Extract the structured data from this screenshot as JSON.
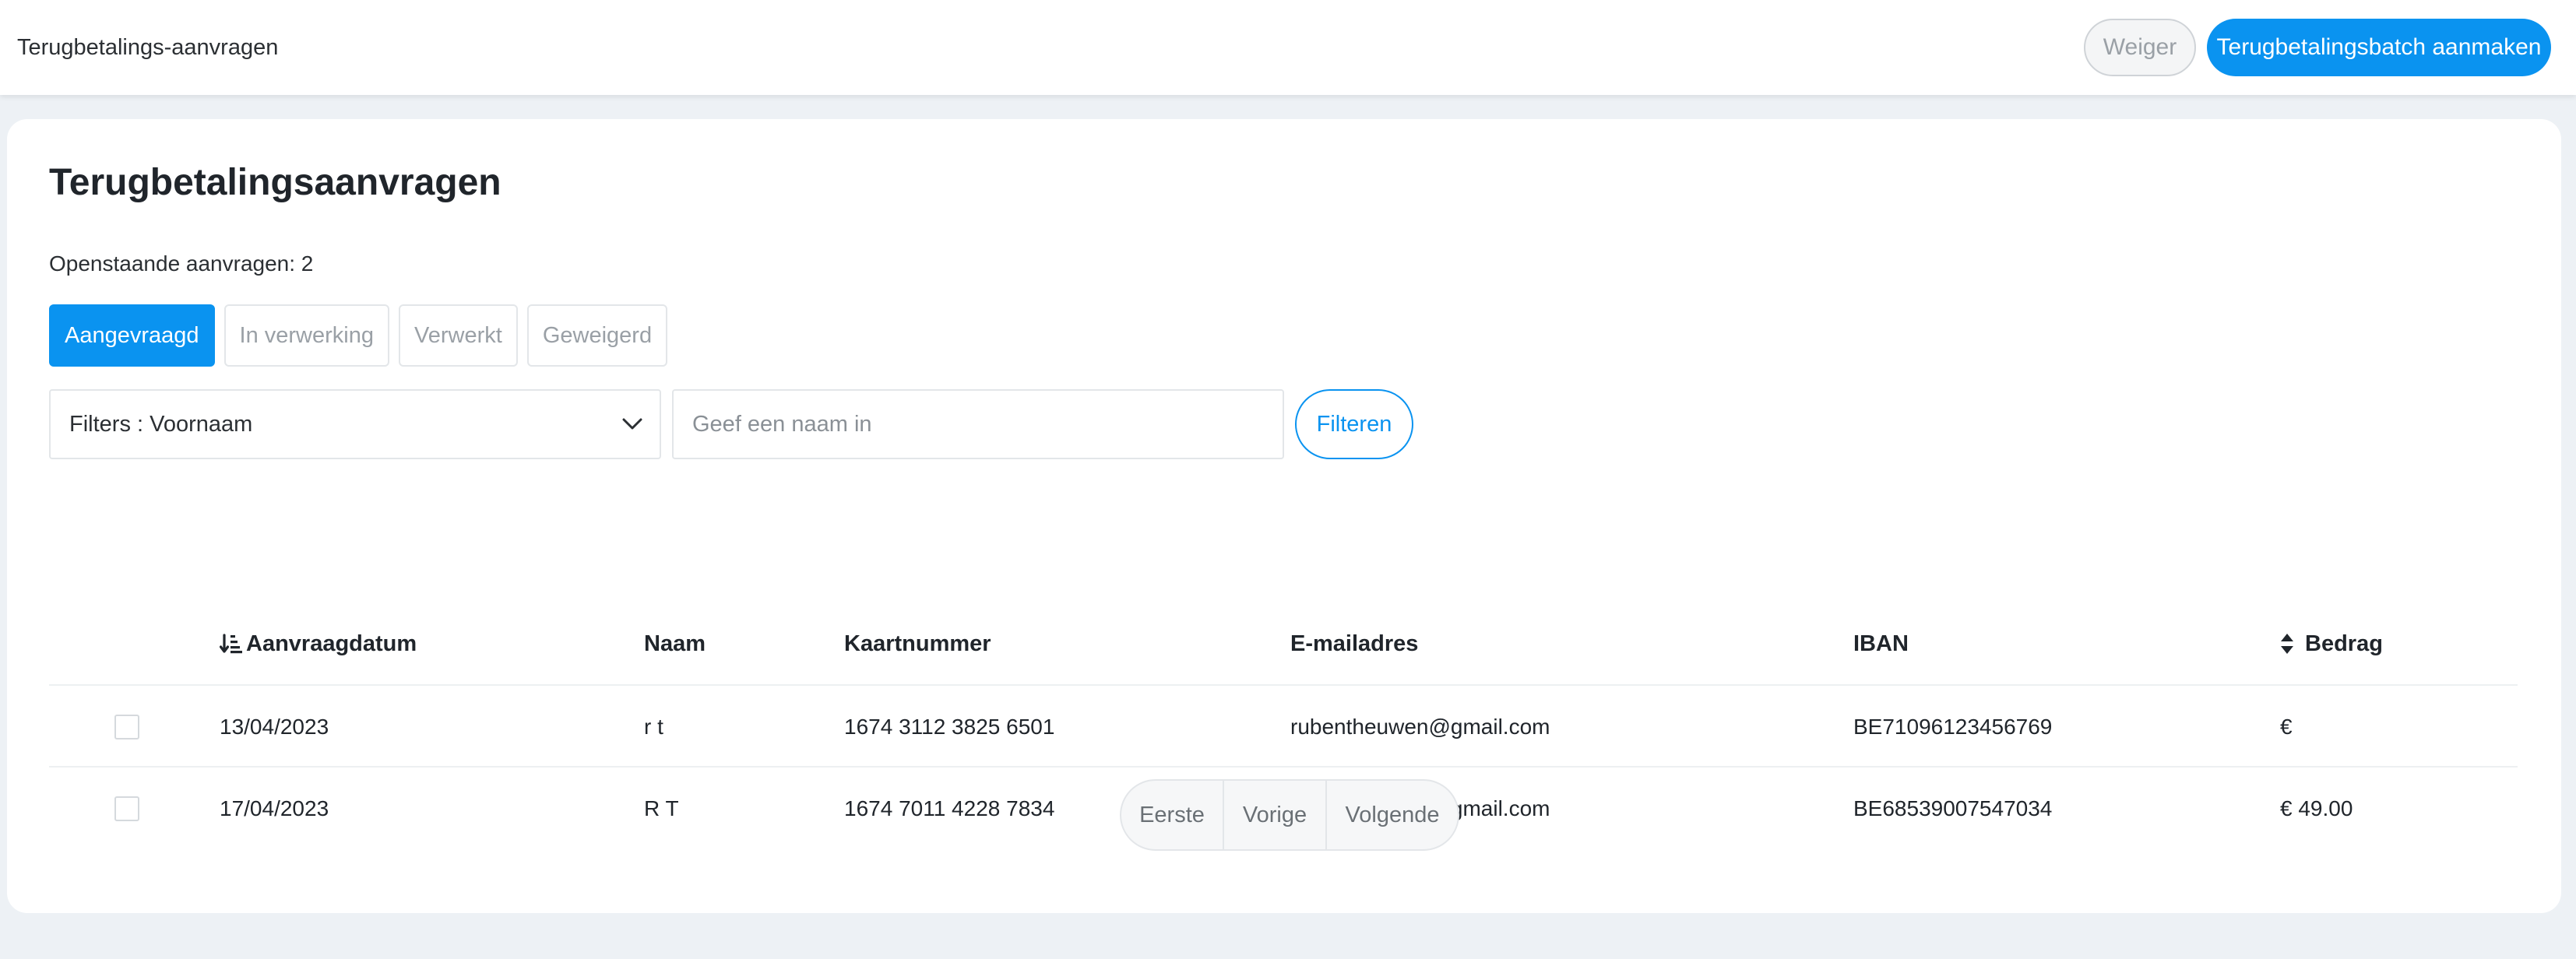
{
  "topbar": {
    "title": "Terugbetalings-aanvragen",
    "reject_label": "Weiger",
    "create_batch_label": "Terugbetalingsbatch aanmaken"
  },
  "main": {
    "title": "Terugbetalingsaanvragen",
    "open_requests": "Openstaande aanvragen: 2",
    "tabs": [
      {
        "label": "Aangevraagd",
        "active": true
      },
      {
        "label": "In verwerking",
        "active": false
      },
      {
        "label": "Verwerkt",
        "active": false
      },
      {
        "label": "Geweigerd",
        "active": false
      }
    ],
    "filter": {
      "selected": "Filters : Voornaam",
      "input_value": "",
      "input_placeholder": "Geef een naam in",
      "button_label": "Filteren"
    },
    "table": {
      "headers": {
        "date": "Aanvraagdatum",
        "name": "Naam",
        "card": "Kaartnummer",
        "email": "E-mailadres",
        "iban": "IBAN",
        "amount": "Bedrag"
      },
      "rows": [
        {
          "checked": false,
          "date": "13/04/2023",
          "name": "r t",
          "card": "1674 3112 3825 6501",
          "email": "rubentheuwen@gmail.com",
          "iban": "BE71096123456769",
          "amount": "€"
        },
        {
          "checked": false,
          "date": "17/04/2023",
          "name": "R T",
          "card": "1674 7011 4228 7834",
          "email": "rubentheuwen@gmail.com",
          "iban": "BE68539007547034",
          "amount": "€ 49.00"
        }
      ]
    },
    "pagination": {
      "first": "Eerste",
      "previous": "Vorige",
      "next": "Volgende"
    }
  },
  "colors": {
    "accent": "#0a93f0",
    "page_bg": "#edf1f5",
    "card_bg": "#ffffff"
  },
  "icons": {
    "date_sort": "sort-descending-icon",
    "amount_sort": "sort-icon",
    "select_chevron": "chevron-down-icon"
  }
}
